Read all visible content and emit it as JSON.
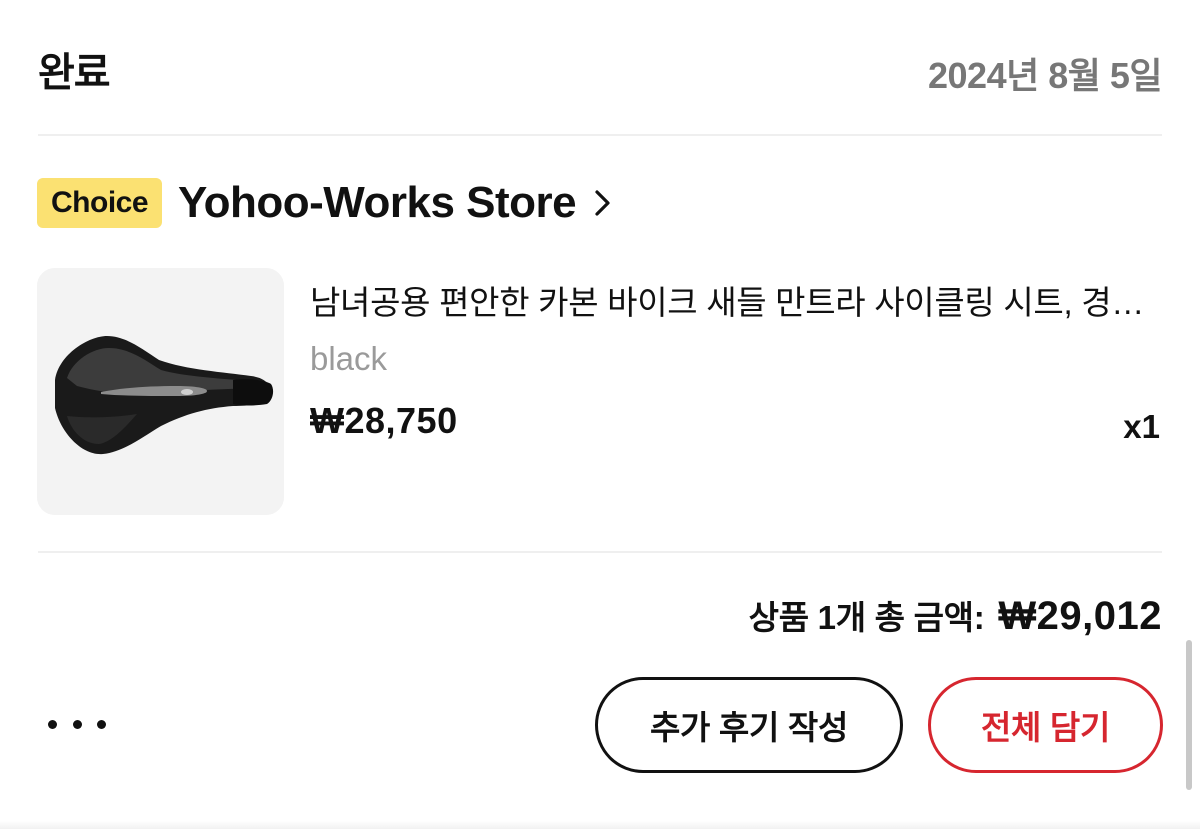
{
  "order": {
    "status": "완료",
    "date": "2024년 8월 5일"
  },
  "store": {
    "badge": "Choice",
    "name": "Yohoo-Works Store",
    "badge_color": "#fbe172"
  },
  "item": {
    "image_icon": "bike-saddle-image",
    "title": "남녀공용 편안한 카본 바이크 새들 만트라 사이클링 시트, 경량 자전거 안장",
    "variant": "black",
    "price": "₩28,750",
    "quantity": "x1"
  },
  "summary": {
    "label": "상품 1개 총 금액:",
    "total": "₩29,012"
  },
  "actions": {
    "more_icon": "more-dots-icon",
    "review_label": "추가 후기 작성",
    "cart_label": "전체 담기",
    "accent_color": "#d6262f"
  }
}
